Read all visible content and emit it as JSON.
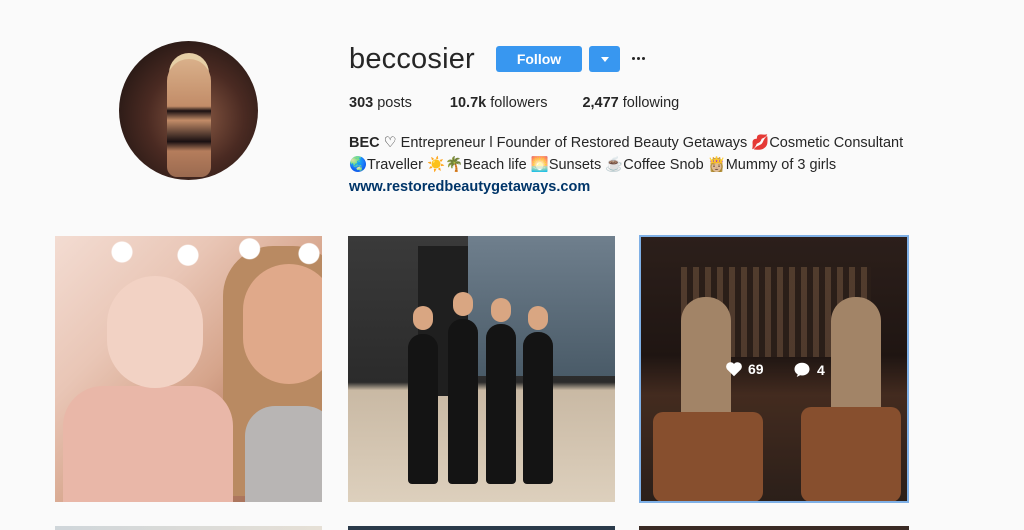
{
  "profile": {
    "username": "beccosier",
    "follow_label": "Follow",
    "stats": {
      "posts_count": "303",
      "posts_label": "posts",
      "followers_count": "10.7k",
      "followers_label": "followers",
      "following_count": "2,477",
      "following_label": "following"
    },
    "bio": {
      "name": "BEC",
      "line1": " ♡ Entrepreneur l Founder of Restored Beauty Getaways 💋Cosmetic Consultant",
      "line2": "🌏Traveller ☀️🌴Beach life 🌅Sunsets ☕Coffee Snob 👸🏼Mummy of 3 girls",
      "link": "www.restoredbeautygetaways.com"
    }
  },
  "posts": [
    {
      "id": "post-1"
    },
    {
      "id": "post-2"
    },
    {
      "id": "post-3",
      "likes": "69",
      "comments": "4"
    }
  ],
  "colors": {
    "accent": "#3897f0",
    "link": "#003569",
    "text": "#262626",
    "background": "#fafafa"
  },
  "icons": [
    "more-icon",
    "chevron-down-icon",
    "heart-icon",
    "comment-icon"
  ]
}
